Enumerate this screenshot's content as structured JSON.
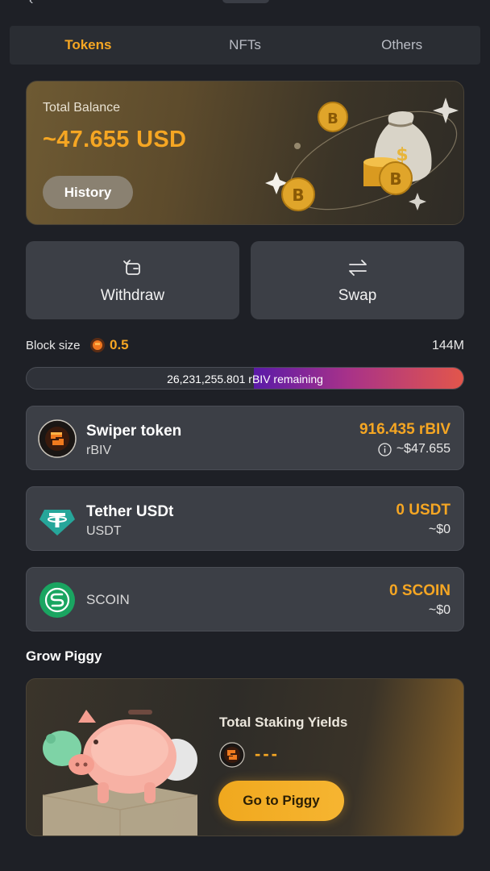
{
  "tabs": [
    {
      "label": "Tokens",
      "active": true
    },
    {
      "label": "NFTs",
      "active": false
    },
    {
      "label": "Others",
      "active": false
    }
  ],
  "balance": {
    "label": "Total Balance",
    "value": "~47.655 USD",
    "history_label": "History"
  },
  "actions": {
    "withdraw_label": "Withdraw",
    "swap_label": "Swap"
  },
  "block": {
    "label": "Block size",
    "value": "0.5",
    "total": "144M",
    "remaining_text": "26,231,255.801 rBIV remaining",
    "filled_fraction": 0.48
  },
  "tokens": [
    {
      "name": "Swiper token",
      "symbol": "rBIV",
      "amount": "916.435 rBIV",
      "usd": "~$47.655",
      "icon": "swiper-token-icon",
      "has_info": true
    },
    {
      "name": "Tether USDt",
      "symbol": "USDT",
      "amount": "0 USDT",
      "usd": "~$0",
      "icon": "tether-icon",
      "has_info": false
    },
    {
      "name": "",
      "symbol": "SCOIN",
      "amount": "0 SCOIN",
      "usd": "~$0",
      "icon": "scoin-icon",
      "has_info": false
    }
  ],
  "grow_piggy": {
    "section_title": "Grow Piggy",
    "card_title": "Total Staking Yields",
    "value": "---",
    "button_label": "Go to Piggy"
  },
  "colors": {
    "accent": "#f5a623",
    "background": "#1e2026",
    "card": "#3c3f46",
    "tether": "#26a69a",
    "scoin": "#1aa561"
  }
}
